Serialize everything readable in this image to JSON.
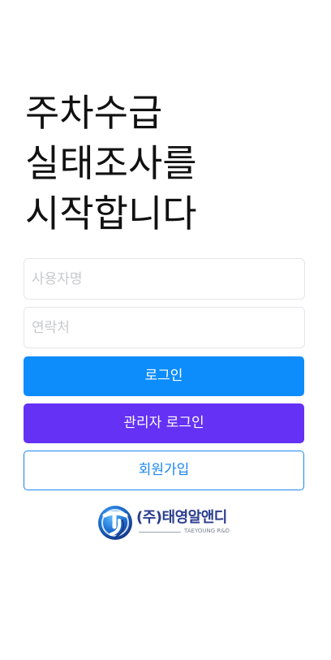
{
  "title": {
    "line1": "주차수급",
    "line2": "실태조사를",
    "line3": "시작합니다"
  },
  "form": {
    "username_placeholder": "사용자명",
    "username_value": "",
    "contact_placeholder": "연락처",
    "contact_value": ""
  },
  "buttons": {
    "login": "로그인",
    "admin_login": "관리자 로그인",
    "signup": "회원가입"
  },
  "logo": {
    "mark_letter": "TY",
    "company_name": "(주)태영알앤디",
    "company_sub": "TAEYOUNG R&D"
  },
  "colors": {
    "primary": "#0d8cfc",
    "admin": "#6431f5",
    "outline": "#1a86f2",
    "logo": "#2a3d8f"
  }
}
